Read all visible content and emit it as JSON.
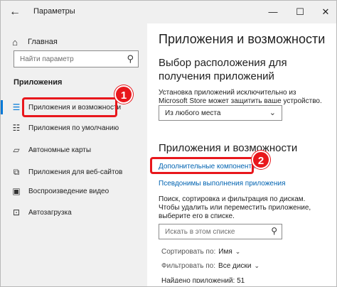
{
  "window": {
    "title": "Параметры",
    "controls": {
      "minimize": "—",
      "maximize": "☐",
      "close": "✕"
    },
    "back": "←"
  },
  "sidebar": {
    "home_label": "Главная",
    "home_icon": "home-icon",
    "search_placeholder": "Найти параметр",
    "section_title": "Приложения",
    "items": [
      {
        "label": "Приложения и возможности",
        "icon": "apps-list-icon",
        "active": true
      },
      {
        "label": "Приложения по умолчанию",
        "icon": "default-apps-icon"
      },
      {
        "label": "Автономные карты",
        "icon": "map-icon"
      },
      {
        "label": "Приложения для веб-сайтов",
        "icon": "web-apps-icon"
      },
      {
        "label": "Воспроизведение видео",
        "icon": "video-icon"
      },
      {
        "label": "Автозагрузка",
        "icon": "startup-icon"
      }
    ]
  },
  "main": {
    "title": "Приложения и возможности",
    "install_section": {
      "heading": "Выбор расположения для получения приложений",
      "description": "Установка приложений исключительно из Microsoft Store может защитить ваше устройство.",
      "dropdown_value": "Из любого места"
    },
    "features_section": {
      "heading": "Приложения и возможности",
      "link_optional": "Дополнительные компоненты",
      "link_aliases": "Псевдонимы выполнения приложения",
      "description": "Поиск, сортировка и фильтрация по дискам. Чтобы удалить или переместить приложение, выберите его в списке.",
      "list_search_placeholder": "Искать в этом списке",
      "sort_label": "Сортировать по:",
      "sort_value": "Имя",
      "filter_label": "Фильтровать по:",
      "filter_value": "Все диски",
      "found_text": "Найдено приложений: 51"
    }
  },
  "annotations": {
    "badge_1": "1",
    "badge_2": "2",
    "highlight_color": "#e8171c"
  },
  "colors": {
    "accent": "#0078d7",
    "link": "#0063b1",
    "sidebar_bg": "#f0f0f0"
  }
}
